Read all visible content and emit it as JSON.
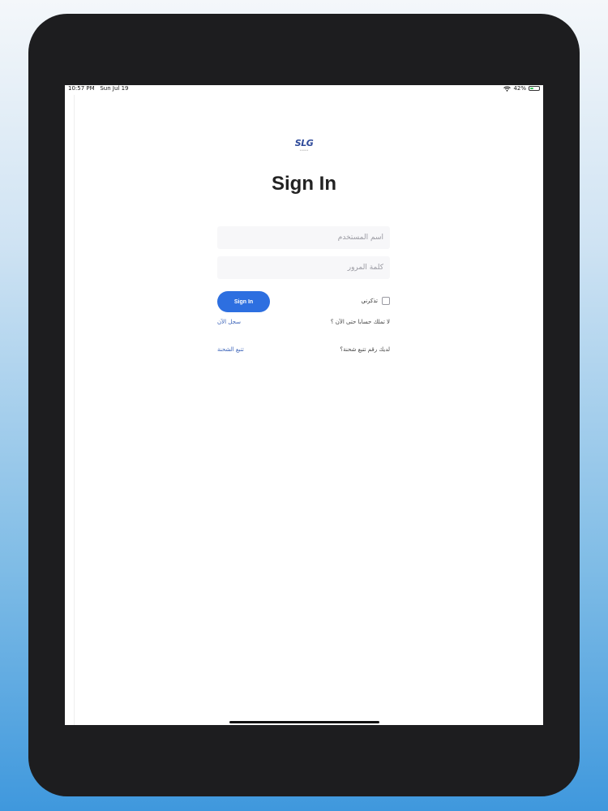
{
  "status_bar": {
    "time": "10:57 PM",
    "date": "Sun Jul 19",
    "battery": "42%",
    "battery_level": 0.42,
    "wifi_icon": "wifi-icon"
  },
  "logo": {
    "text": "SLG"
  },
  "page": {
    "title": "Sign In"
  },
  "form": {
    "username_placeholder": "اسم المستخدم",
    "username_value": "",
    "password_placeholder": "كلمة المرور",
    "password_value": "",
    "remember_label": "تذكرني",
    "remember_checked": false,
    "signin_button": "Sign In"
  },
  "links": {
    "no_account_text": "لا تملك حسابا حتى الآن ؟",
    "register": "سجل الآن",
    "have_tracking_text": "لديك رقم تتبع شحنة؟",
    "track": "تتبع الشحنة"
  },
  "colors": {
    "accent": "#2d6fe0",
    "link": "#3a62b8",
    "bezel": "#1d1d1f"
  }
}
